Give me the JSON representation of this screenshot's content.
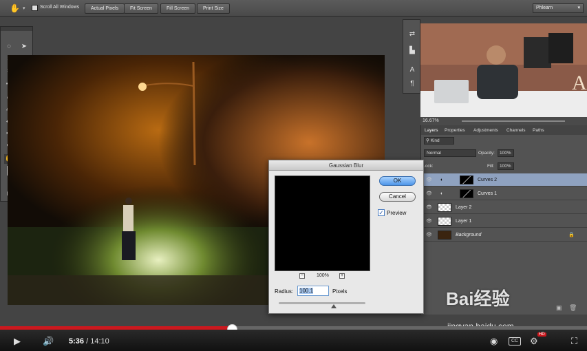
{
  "options_bar": {
    "scroll_all_label": "Scroll All Windows",
    "buttons": [
      "Actual Pixels",
      "Fit Screen",
      "Fill Screen",
      "Print Size"
    ],
    "workspace": "Phlearn"
  },
  "navigator": {
    "zoom": "16.67%"
  },
  "layers_panel": {
    "tabs": [
      "Layers",
      "Properties",
      "Adjustments",
      "Channels",
      "Paths"
    ],
    "kind_filter": "Kind",
    "blend_mode": "Normal",
    "opacity_label": "Opacity:",
    "opacity_value": "100%",
    "lock_label": "Lock:",
    "fill_label": "Fill:",
    "fill_value": "100%",
    "layers": [
      "Curves 2",
      "Curves 1",
      "Layer 2",
      "Layer 1",
      "Background"
    ]
  },
  "dialog": {
    "title": "Gaussian Blur",
    "ok": "OK",
    "cancel": "Cancel",
    "preview_label": "Preview",
    "preview_checked": true,
    "zoom": "100%",
    "radius_label": "Radius:",
    "radius_value": "100.1",
    "radius_unit": "Pixels"
  },
  "player": {
    "current_time": "5:36",
    "duration": "/ 14:10",
    "progress_fraction": 0.395,
    "hd_badge": "HD"
  },
  "watermark": {
    "logo": "Bai经验",
    "url": "jingyan.baidu.com"
  },
  "colors": {
    "accent_red": "#cc181e",
    "selection_blue": "#4d95e8"
  }
}
